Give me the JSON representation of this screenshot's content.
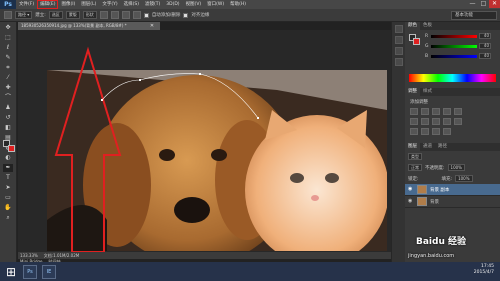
{
  "app": {
    "logo": "Ps"
  },
  "menus": [
    "文件(F)",
    "编辑(E)",
    "图像(I)",
    "图层(L)",
    "文字(Y)",
    "选择(S)",
    "滤镜(T)",
    "3D(D)",
    "视图(V)",
    "窗口(W)",
    "帮助(H)"
  ],
  "highlighted_menu_index": 1,
  "window_controls": {
    "minimize": "—",
    "maximize": "□",
    "close": "✕"
  },
  "options_bar": {
    "feather_label": "羽化:",
    "feather_value": "0 像素",
    "select_label": "选区",
    "mask_label": "蒙版",
    "shape_label": "形状",
    "auto_label": "自动添加/删除",
    "align_label": "对齐边缘"
  },
  "workspace": "基本功能",
  "document": {
    "tab": "185930526350914.jpg @ 133%(背景 副本, RGB/8#) *",
    "close": "✕"
  },
  "status": {
    "zoom": "133.33%",
    "doc": "文档:1.01M/2.02M"
  },
  "mini_bridge": [
    "Mini Bridge",
    "时间轴"
  ],
  "color_panel": {
    "tabs": [
      "颜色",
      "色板"
    ],
    "channels": [
      {
        "label": "R",
        "value": "40"
      },
      {
        "label": "G",
        "value": "40"
      },
      {
        "label": "B",
        "value": "40"
      }
    ],
    "accent": "#e02020"
  },
  "adjustments_panel": {
    "tabs": [
      "调整",
      "样式"
    ],
    "title": "添加调整"
  },
  "layers_panel": {
    "tabs": [
      "图层",
      "通道",
      "路径"
    ],
    "kind_label": "类型",
    "blend_mode": "正常",
    "opacity_label": "不透明度:",
    "opacity": "100%",
    "lock_label": "锁定:",
    "fill_label": "填充:",
    "fill": "100%",
    "layers": [
      {
        "name": "背景 副本",
        "selected": true
      },
      {
        "name": "背景",
        "selected": false
      }
    ]
  },
  "taskbar": {
    "apps": [
      "Ps",
      "IE"
    ],
    "time": "17:45",
    "date": "2015/4/7"
  },
  "watermark": {
    "brand": "Baidu 经验",
    "url": "jingyan.baidu.com"
  }
}
